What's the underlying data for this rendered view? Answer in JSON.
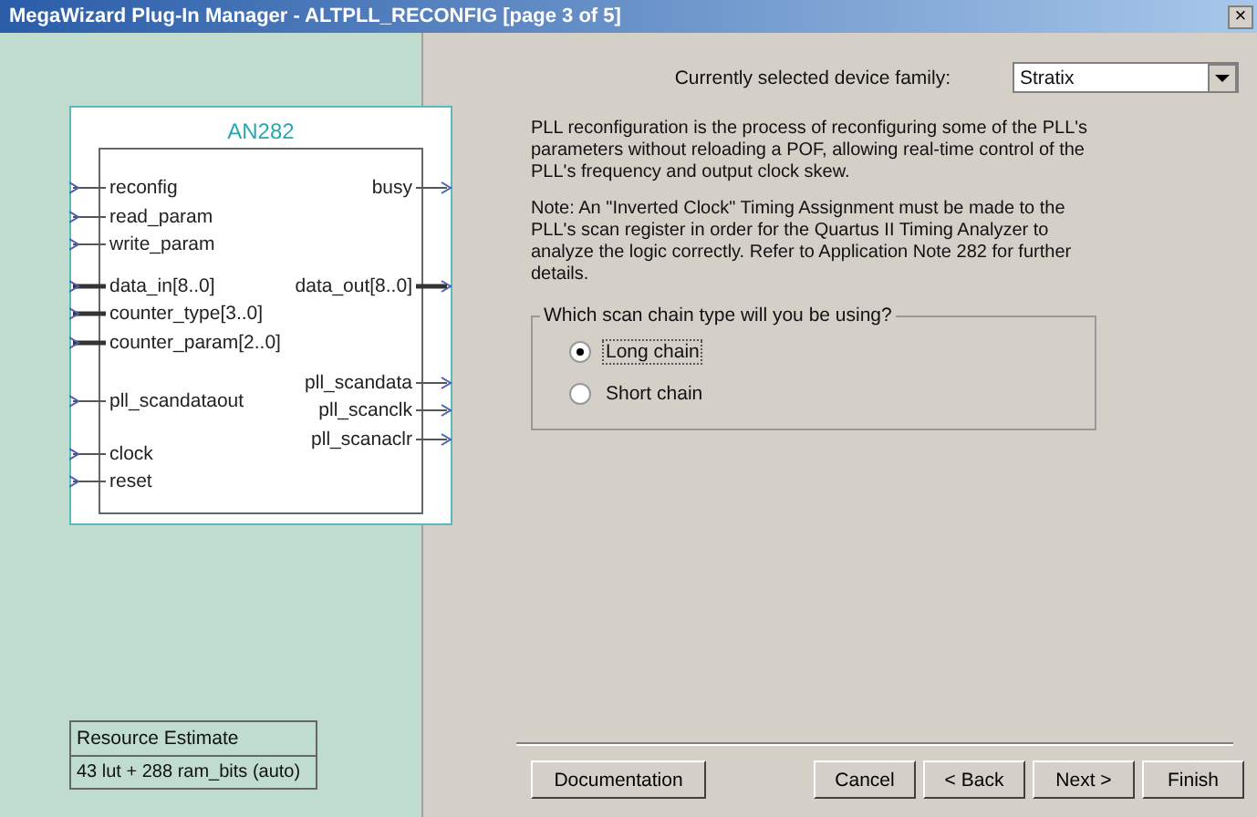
{
  "window": {
    "title": "MegaWizard Plug-In Manager - ALTPLL_RECONFIG [page 3 of 5]",
    "close": "×"
  },
  "symbol": {
    "title": "AN282",
    "left_pins": [
      {
        "name": "reconfig",
        "bus": false
      },
      {
        "name": "read_param",
        "bus": false
      },
      {
        "name": "write_param",
        "bus": false
      },
      {
        "name": "data_in[8..0]",
        "bus": true
      },
      {
        "name": "counter_type[3..0]",
        "bus": true
      },
      {
        "name": "counter_param[2..0]",
        "bus": true
      },
      {
        "name": "pll_scandataout",
        "bus": false
      },
      {
        "name": "clock",
        "bus": false
      },
      {
        "name": "reset",
        "bus": false
      }
    ],
    "right_pins": [
      {
        "name": "busy",
        "bus": false
      },
      {
        "name": "data_out[8..0]",
        "bus": true
      },
      {
        "name": "pll_scandata",
        "bus": false
      },
      {
        "name": "pll_scanclk",
        "bus": false
      },
      {
        "name": "pll_scanaclr",
        "bus": false
      }
    ]
  },
  "resource_estimate": {
    "title": "Resource Estimate",
    "value": "43 lut + 288 ram_bits (auto)"
  },
  "device_family": {
    "label": "Currently selected device family:",
    "value": "Stratix"
  },
  "paragraphs": [
    "PLL reconfiguration is the process of reconfiguring some of the PLL's parameters without reloading a POF, allowing real-time control of the PLL's frequency and output clock skew.",
    "Note: An \"Inverted Clock\" Timing Assignment must be made to the PLL's scan register in order for the Quartus II Timing Analyzer to analyze the logic correctly.  Refer to Application Note 282 for further details."
  ],
  "scan_chain": {
    "legend": "Which scan chain type will you be using?",
    "options": [
      {
        "label": "Long chain",
        "selected": true
      },
      {
        "label": "Short chain",
        "selected": false
      }
    ]
  },
  "buttons": [
    {
      "label": "Documentation"
    },
    {
      "label": "Cancel"
    },
    {
      "label": "< Back"
    },
    {
      "label": "Next >"
    },
    {
      "label": "Finish"
    }
  ]
}
